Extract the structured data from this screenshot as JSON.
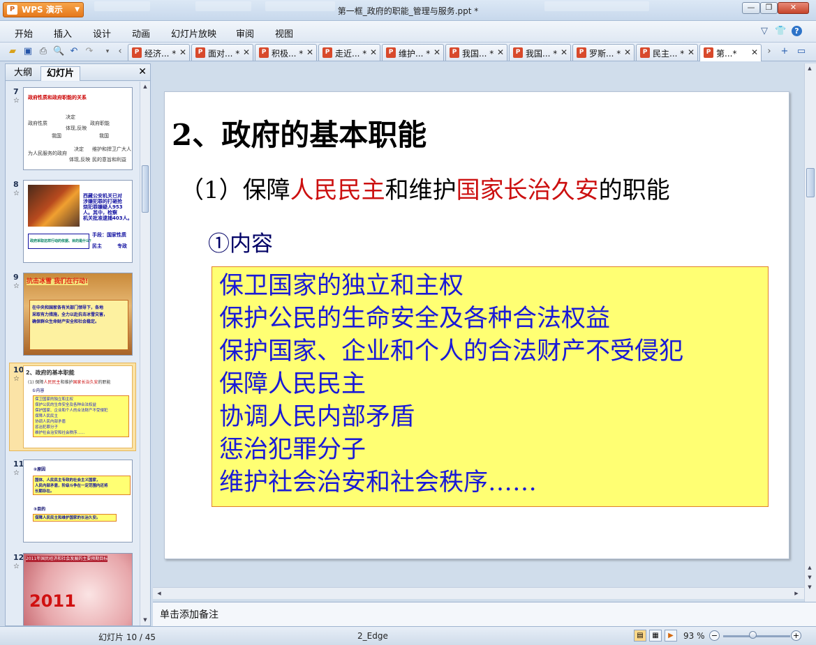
{
  "window": {
    "app_button": "WPS 演示",
    "title": "第一框_政府的职能_管理与服务.ppt *"
  },
  "menu": {
    "items": [
      "开始",
      "插入",
      "设计",
      "动画",
      "幻灯片放映",
      "审阅",
      "视图"
    ],
    "help_glyph": "?"
  },
  "tabs": [
    {
      "label": "经济...",
      "modified": "*",
      "active": false
    },
    {
      "label": "面对...",
      "modified": "*",
      "active": false
    },
    {
      "label": "积极...",
      "modified": "*",
      "active": false
    },
    {
      "label": "走近...",
      "modified": "*",
      "active": false
    },
    {
      "label": "维护...",
      "modified": "*",
      "active": false
    },
    {
      "label": "我国...",
      "modified": "*",
      "active": false
    },
    {
      "label": "我国...",
      "modified": "*",
      "active": false
    },
    {
      "label": "罗斯...",
      "modified": "*",
      "active": false
    },
    {
      "label": "民主...",
      "modified": "*",
      "active": false
    },
    {
      "label": "第...",
      "modified": "*",
      "active": true
    }
  ],
  "pane": {
    "tab_outline": "大纲",
    "tab_slides": "幻灯片",
    "thumbnails": [
      {
        "num": "7",
        "title": "政府性质和政府职能的关系",
        "lines": [
          "决定",
          "政府性质",
          "政府职能",
          "体现,反映",
          "我国",
          "我国",
          "决定",
          "维护和捍卫广大人",
          "为人民服务的政府",
          "体现,反映",
          "民的意旨和利益"
        ]
      },
      {
        "num": "8",
        "text": [
          "西藏公安机关已对",
          "涉嫌犯罪的打砸抢",
          "烧犯罪嫌疑人953",
          "人。其中，检察",
          "机关批准逮捕403人。"
        ],
        "box": "政府采取这样行动的依据、目的是什么？",
        "note": [
          "手段：国家性质",
          "民主",
          "专政"
        ]
      },
      {
        "num": "9",
        "banner": "抗击冰雪 我们在行动!",
        "text": [
          "在中央和国家各有关部门领导下，各地",
          "采取有力措施，全力以赴抗击冰雪灾害，",
          "确保群众生命财产安全和社会稳定。"
        ]
      },
      {
        "num": "10",
        "title": "2、政府的基本职能",
        "sub_a": "(1) 保障",
        "sub_red": "人民民主",
        "sub_b": "和维护",
        "sub_red2": "国家长治久安",
        "sub_c": "的职能",
        "point": "①内容",
        "lines": [
          "保卫国家的独立和主权",
          "保护公民的生命安全及各种合法权益",
          "保护国家、企业和个人的合法财产不受侵犯",
          "保障人民民主",
          "协调人民内部矛盾",
          "惩治犯罪分子",
          "维护社会治安和社会秩序……"
        ]
      },
      {
        "num": "11",
        "h1": "②原因",
        "box1": [
          "国体、人民民主专政的社会主义国家，",
          "人民内部矛盾，阶级斗争在一定范围内还将",
          "长期存在。"
        ],
        "h2": "③目的",
        "box2": "保障人民民主和维护国家的长治久安。"
      },
      {
        "num": "12",
        "title": "2011年国民经济和社会发展的主要预期目标",
        "year": "2011"
      }
    ]
  },
  "slide": {
    "title": "2、政府的基本职能",
    "subtitle_a": "（1）保障",
    "subtitle_hl1": "人民民主",
    "subtitle_b": "和维护",
    "subtitle_hl2": "国家长治久安",
    "subtitle_c": "的职能",
    "point": "①内容",
    "content_lines": [
      "保卫国家的独立和主权",
      "保护公民的生命安全及各种合法权益",
      "保护国家、企业和个人的合法财产不受侵犯",
      "保障人民民主",
      "协调人民内部矛盾",
      "惩治犯罪分子",
      "维护社会治安和社会秩序……"
    ]
  },
  "notes_placeholder": "单击添加备注",
  "status": {
    "slide_pos": "幻灯片 10 / 45",
    "theme": "2_Edge",
    "zoom": "93 %",
    "zoom_level": 0.45
  },
  "colors": {
    "accent_red": "#cc1010",
    "content_blue": "#1a1ad6",
    "box_yellow": "#ffff73",
    "wps_orange": "#e5781b"
  }
}
